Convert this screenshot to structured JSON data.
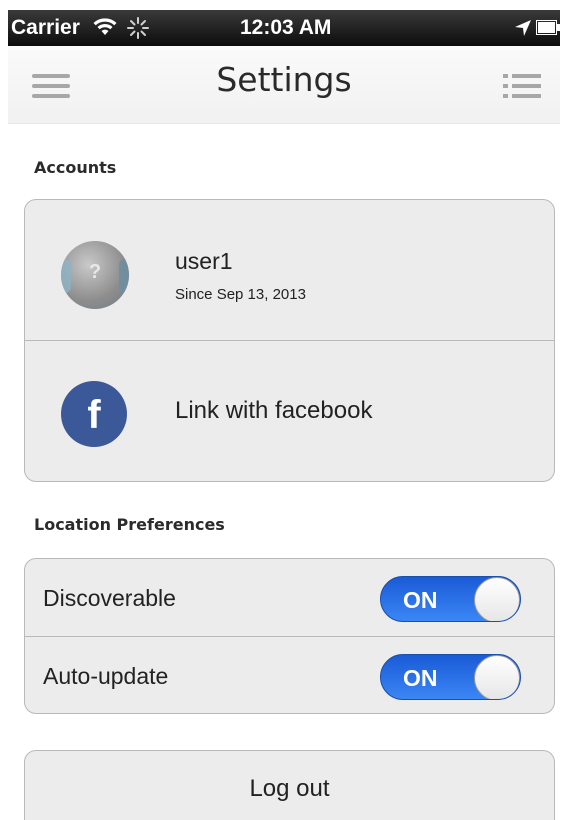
{
  "status_bar": {
    "carrier": "Carrier",
    "time": "12:03 AM",
    "wifi_icon": "wifi-icon",
    "activity_icon": "spinner-icon",
    "location_icon": "location-arrow-icon",
    "battery_icon": "battery-icon"
  },
  "nav": {
    "title": "Settings",
    "left_icon": "menu-icon",
    "right_icon": "list-icon"
  },
  "accounts": {
    "header": "Accounts",
    "user": {
      "name": "user1",
      "since": "Since Sep 13, 2013",
      "avatar_text": "?"
    },
    "facebook": {
      "icon_text": "f",
      "label": "Link with facebook"
    }
  },
  "location": {
    "header": "Location Preferences",
    "items": [
      {
        "label": "Discoverable",
        "toggle": "ON"
      },
      {
        "label": "Auto-update",
        "toggle": "ON"
      }
    ]
  },
  "logout": {
    "label": "Log out"
  },
  "colors": {
    "toggle_on": "#2f7bef",
    "facebook": "#3b5998",
    "card_bg": "#ececec",
    "status_bar": "#1a1a1a"
  }
}
